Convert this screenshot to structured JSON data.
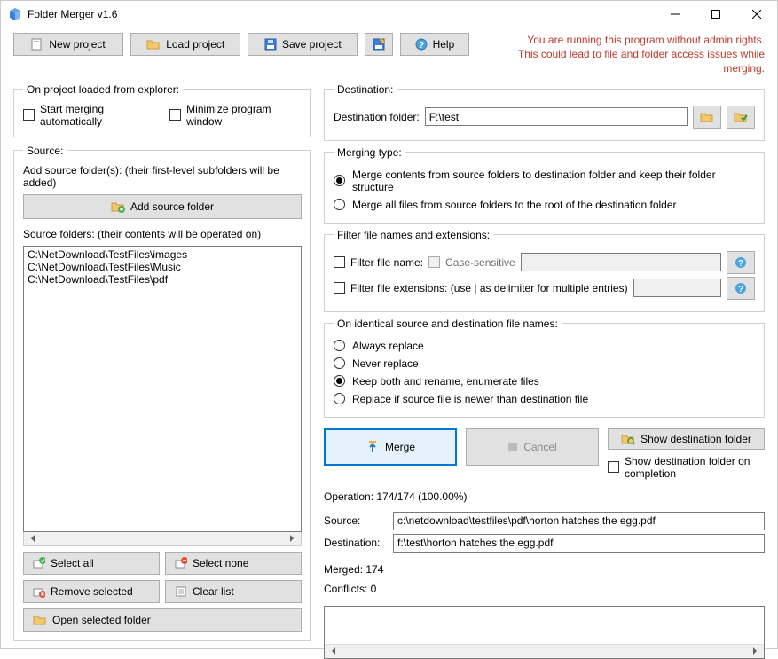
{
  "window": {
    "title": "Folder Merger v1.6"
  },
  "toolbar": {
    "new_project": "New project",
    "load_project": "Load project",
    "save_project": "Save project",
    "help": "Help"
  },
  "admin_warning": {
    "line1": "You are running this program without admin rights.",
    "line2": "This could lead to file and folder access issues while merging."
  },
  "on_load": {
    "legend": "On project loaded from explorer:",
    "start_merging": "Start merging automatically",
    "minimize": "Minimize program window"
  },
  "source": {
    "legend": "Source:",
    "add_desc": "Add source folder(s): (their first-level subfolders will be added)",
    "add_btn": "Add source folder",
    "list_desc": "Source folders: (their contents will be operated on)",
    "items": [
      "C:\\NetDownload\\TestFiles\\images",
      "C:\\NetDownload\\TestFiles\\Music",
      "C:\\NetDownload\\TestFiles\\pdf"
    ],
    "select_all": "Select all",
    "select_none": "Select none",
    "remove_selected": "Remove selected",
    "clear_list": "Clear list",
    "open_selected": "Open selected folder"
  },
  "destination": {
    "legend": "Destination:",
    "label": "Destination folder:",
    "value": "F:\\test"
  },
  "merging_type": {
    "legend": "Merging type:",
    "opt_keep_structure": "Merge contents from source folders to destination folder and keep their folder structure",
    "opt_to_root": "Merge all files from source folders to the root of the destination folder",
    "selected": 0
  },
  "filter": {
    "legend": "Filter file names and extensions:",
    "filter_name": "Filter file name:",
    "case_sensitive": "Case-sensitive",
    "filter_ext": "Filter file extensions: (use | as delimiter for multiple entries)"
  },
  "identical": {
    "legend": "On identical source and destination file names:",
    "opt_always": "Always replace",
    "opt_never": "Never replace",
    "opt_keep_both": "Keep both and rename, enumerate files",
    "opt_newer": "Replace if source file is newer than destination file",
    "selected": 2
  },
  "actions": {
    "merge": "Merge",
    "cancel": "Cancel",
    "show_dest": "Show destination folder",
    "show_on_completion": "Show destination folder on completion"
  },
  "status": {
    "operation": "Operation: 174/174 (100.00%)",
    "source_label": "Source:",
    "source_value": "c:\\netdownload\\testfiles\\pdf\\horton hatches the egg.pdf",
    "dest_label": "Destination:",
    "dest_value": "f:\\test\\horton hatches the egg.pdf",
    "merged": "Merged: 174",
    "conflicts": "Conflicts: 0"
  }
}
